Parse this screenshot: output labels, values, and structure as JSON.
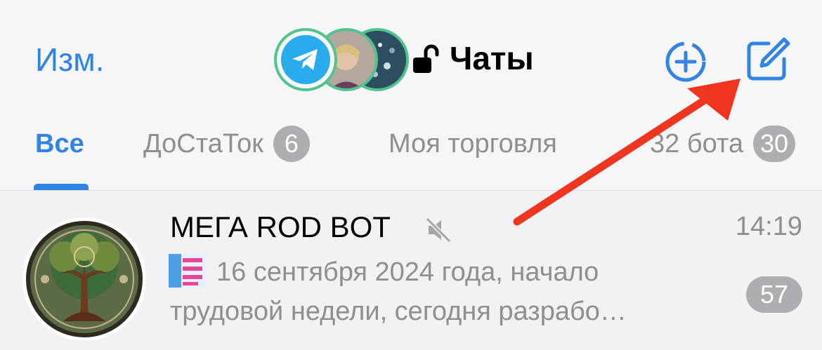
{
  "header": {
    "edit_label": "Изм.",
    "title": "Чаты",
    "accounts": [
      "telegram-icon",
      "account-photo",
      "account-photo"
    ],
    "accent_color": "#2f84e4"
  },
  "tabs": [
    {
      "label": "Все",
      "selected": true
    },
    {
      "label": "ДоСтаТок",
      "badge": "6"
    },
    {
      "label": "Моя торговля"
    },
    {
      "label": "32 бота",
      "badge": "30"
    }
  ],
  "chats": [
    {
      "name": "МЕГА ROD BOT",
      "muted": true,
      "time": "14:19",
      "preview_line1": "16 сентября 2024 года, начало",
      "preview_line2": "трудовой недели, сегодня разрабо…",
      "unread": "57"
    }
  ],
  "annotation": {
    "color": "#f0351f"
  }
}
